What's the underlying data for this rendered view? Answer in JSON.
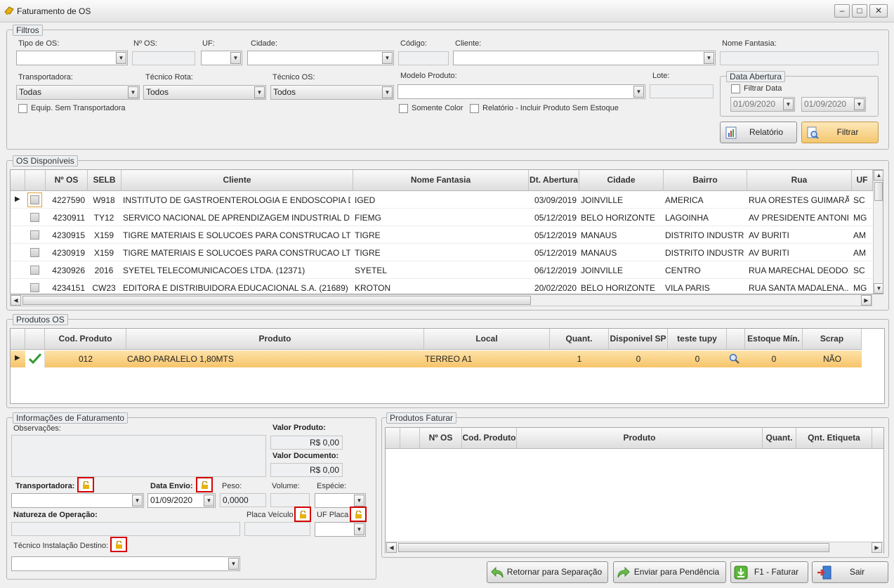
{
  "window": {
    "title": "Faturamento de OS"
  },
  "filters": {
    "group_label": "Filtros",
    "tipo_os_label": "Tipo de OS:",
    "num_os_label": "Nº OS:",
    "uf_label": "UF:",
    "cidade_label": "Cidade:",
    "codigo_label": "Código:",
    "cliente_label": "Cliente:",
    "nome_fantasia_label": "Nome Fantasia:",
    "transportadora_label": "Transportadora:",
    "transportadora_value": "Todas",
    "tecnico_rota_label": "Técnico Rota:",
    "tecnico_rota_value": "Todos",
    "tecnico_os_label": "Técnico OS:",
    "tecnico_os_value": "Todos",
    "modelo_produto_label": "Modelo Produto:",
    "lote_label": "Lote:",
    "equip_sem_transp": "Equip. Sem Transportadora",
    "somente_color": "Somente Color",
    "relatorio_incluir": "Relatório - Incluir Produto Sem Estoque",
    "data_abertura_label": "Data Abertura",
    "filtrar_data": "Filtrar Data",
    "date_from": "01/09/2020",
    "date_to": "01/09/2020",
    "relatorio_button": "Relatório",
    "filtrar_button": "Filtrar"
  },
  "os_disponiveis": {
    "group_label": "OS Disponíveis",
    "columns": [
      "Nº OS",
      "SELB",
      "Cliente",
      "Nome Fantasia",
      "Dt. Abertura",
      "Cidade",
      "Bairro",
      "Rua",
      "UF"
    ],
    "rows": [
      [
        "4227590",
        "W918",
        "INSTITUTO DE GASTROENTEROLOGIA E ENDOSCOPIA DI...",
        "IGED",
        "03/09/2019",
        "JOINVILLE",
        "AMERICA",
        "RUA ORESTES GUIMARÃ...",
        "SC"
      ],
      [
        "4230911",
        "TY12",
        "SERVICO NACIONAL DE APRENDIZAGEM INDUSTRIAL DE...",
        "FIEMG",
        "05/12/2019",
        "BELO HORIZONTE",
        "LAGOINHA",
        "AV PRESIDENTE ANTONI...",
        "MG"
      ],
      [
        "4230915",
        "X159",
        "TIGRE MATERIAIS E SOLUCOES PARA CONSTRUCAO LTD...",
        "TIGRE",
        "05/12/2019",
        "MANAUS",
        "DISTRITO INDUSTRI...",
        "AV BURITI",
        "AM"
      ],
      [
        "4230919",
        "X159",
        "TIGRE MATERIAIS E SOLUCOES PARA CONSTRUCAO LTD...",
        "TIGRE",
        "05/12/2019",
        "MANAUS",
        "DISTRITO INDUSTRI...",
        "AV BURITI",
        "AM"
      ],
      [
        "4230926",
        "2016",
        "SYETEL TELECOMUNICACOES LTDA. (12371)",
        "SYETEL",
        "06/12/2019",
        "JOINVILLE",
        "CENTRO",
        "RUA MARECHAL DEODO...",
        "SC"
      ],
      [
        "4234151",
        "CW23",
        "EDITORA E DISTRIBUIDORA EDUCACIONAL S.A. (21689)",
        "KROTON",
        "20/02/2020",
        "BELO HORIZONTE",
        "VILA PARIS",
        "RUA SANTA MADALENA...",
        "MG"
      ]
    ]
  },
  "produtos_os": {
    "group_label": "Produtos OS",
    "columns": [
      "Cod. Produto",
      "Produto",
      "Local",
      "Quant.",
      "Disponivel SP",
      "teste tupy",
      "",
      "Estoque Mín.",
      "Scrap"
    ],
    "rows": [
      [
        "012",
        "CABO PARALELO 1,80MTS",
        "TERREO A1",
        "1",
        "0",
        "0",
        "",
        "0",
        "NÃO"
      ]
    ]
  },
  "info_faturamento": {
    "group_label": "Informações de Faturamento",
    "observacoes_label": "Observações:",
    "valor_produto_label": "Valor Produto:",
    "valor_produto": "R$ 0,00",
    "valor_documento_label": "Valor Documento:",
    "valor_documento": "R$ 0,00",
    "transportadora_label": "Transportadora:",
    "data_envio_label": "Data Envio:",
    "data_envio": "01/09/2020",
    "peso_label": "Peso:",
    "peso": "0,0000",
    "volume_label": "Volume:",
    "especie_label": "Espécie:",
    "natureza_label": "Natureza de Operação:",
    "placa_label": "Placa Veículo",
    "uf_placa_label": "UF Placa",
    "tecnico_destino_label": "Técnico Instalação Destino:"
  },
  "produtos_faturar": {
    "group_label": "Produtos Faturar",
    "columns": [
      "Nº OS",
      "Cod. Produto",
      "Produto",
      "Quant.",
      "Qnt. Etiqueta"
    ]
  },
  "actions": {
    "retornar": "Retornar para Separação",
    "enviar": "Enviar para Pendência",
    "faturar": "F1 - Faturar",
    "sair": "Sair"
  }
}
